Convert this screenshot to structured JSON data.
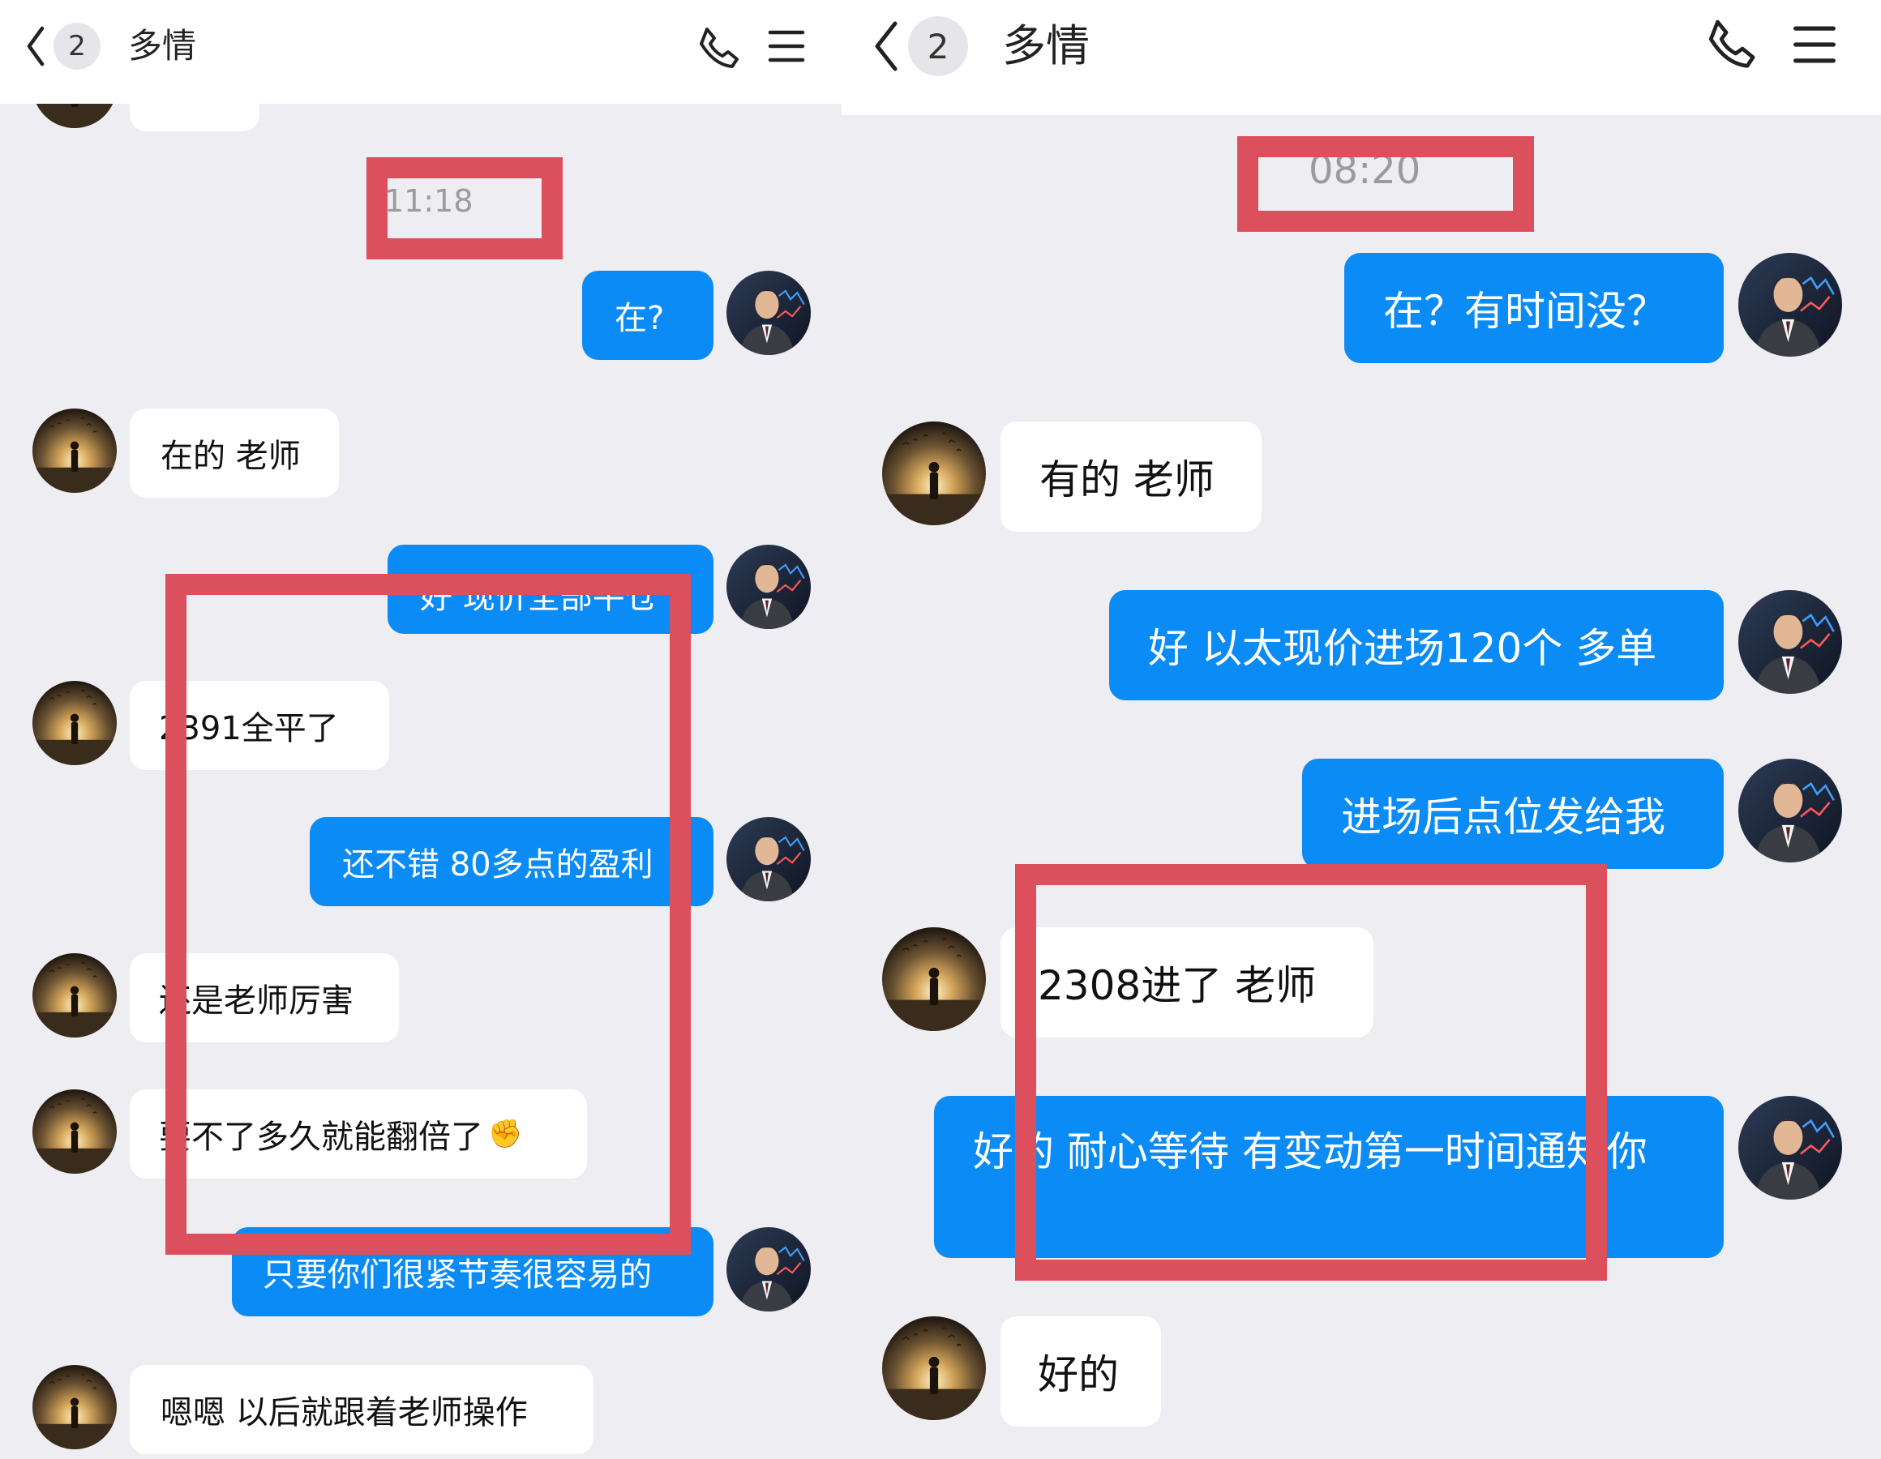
{
  "left": {
    "header": {
      "badge": "2",
      "title": "多情"
    },
    "timestamp": "11:18",
    "messages": [
      {
        "text": "在?"
      },
      {
        "text": "在的 老师"
      },
      {
        "text": "好  现价全部平仓"
      },
      {
        "text": "2391全平了"
      },
      {
        "text": "还不错  80多点的盈利"
      },
      {
        "text": "还是老师厉害"
      },
      {
        "text": "要不了多久就能翻倍了",
        "emoji": "✊"
      },
      {
        "text": "只要你们很紧节奏很容易的"
      },
      {
        "text": "嗯嗯  以后就跟着老师操作"
      }
    ]
  },
  "right": {
    "header": {
      "badge": "2",
      "title": "多情"
    },
    "timestamp": "08:20",
    "messages": [
      {
        "text": "在？有时间没？"
      },
      {
        "text": "有的 老师"
      },
      {
        "text": "好  以太现价进场120个 多单"
      },
      {
        "text": "进场后点位发给我"
      },
      {
        "text": "2308进了  老师"
      },
      {
        "text": "好的  耐心等待  有变动第一时间通知你"
      },
      {
        "text": "好的"
      }
    ]
  },
  "colors": {
    "bubble_out": "#0a8bf5",
    "bubble_in": "#ffffff",
    "background": "#ededf2",
    "annotation": "#dc4f5c"
  },
  "icons": [
    "back-chevron-icon",
    "phone-icon",
    "menu-icon"
  ]
}
